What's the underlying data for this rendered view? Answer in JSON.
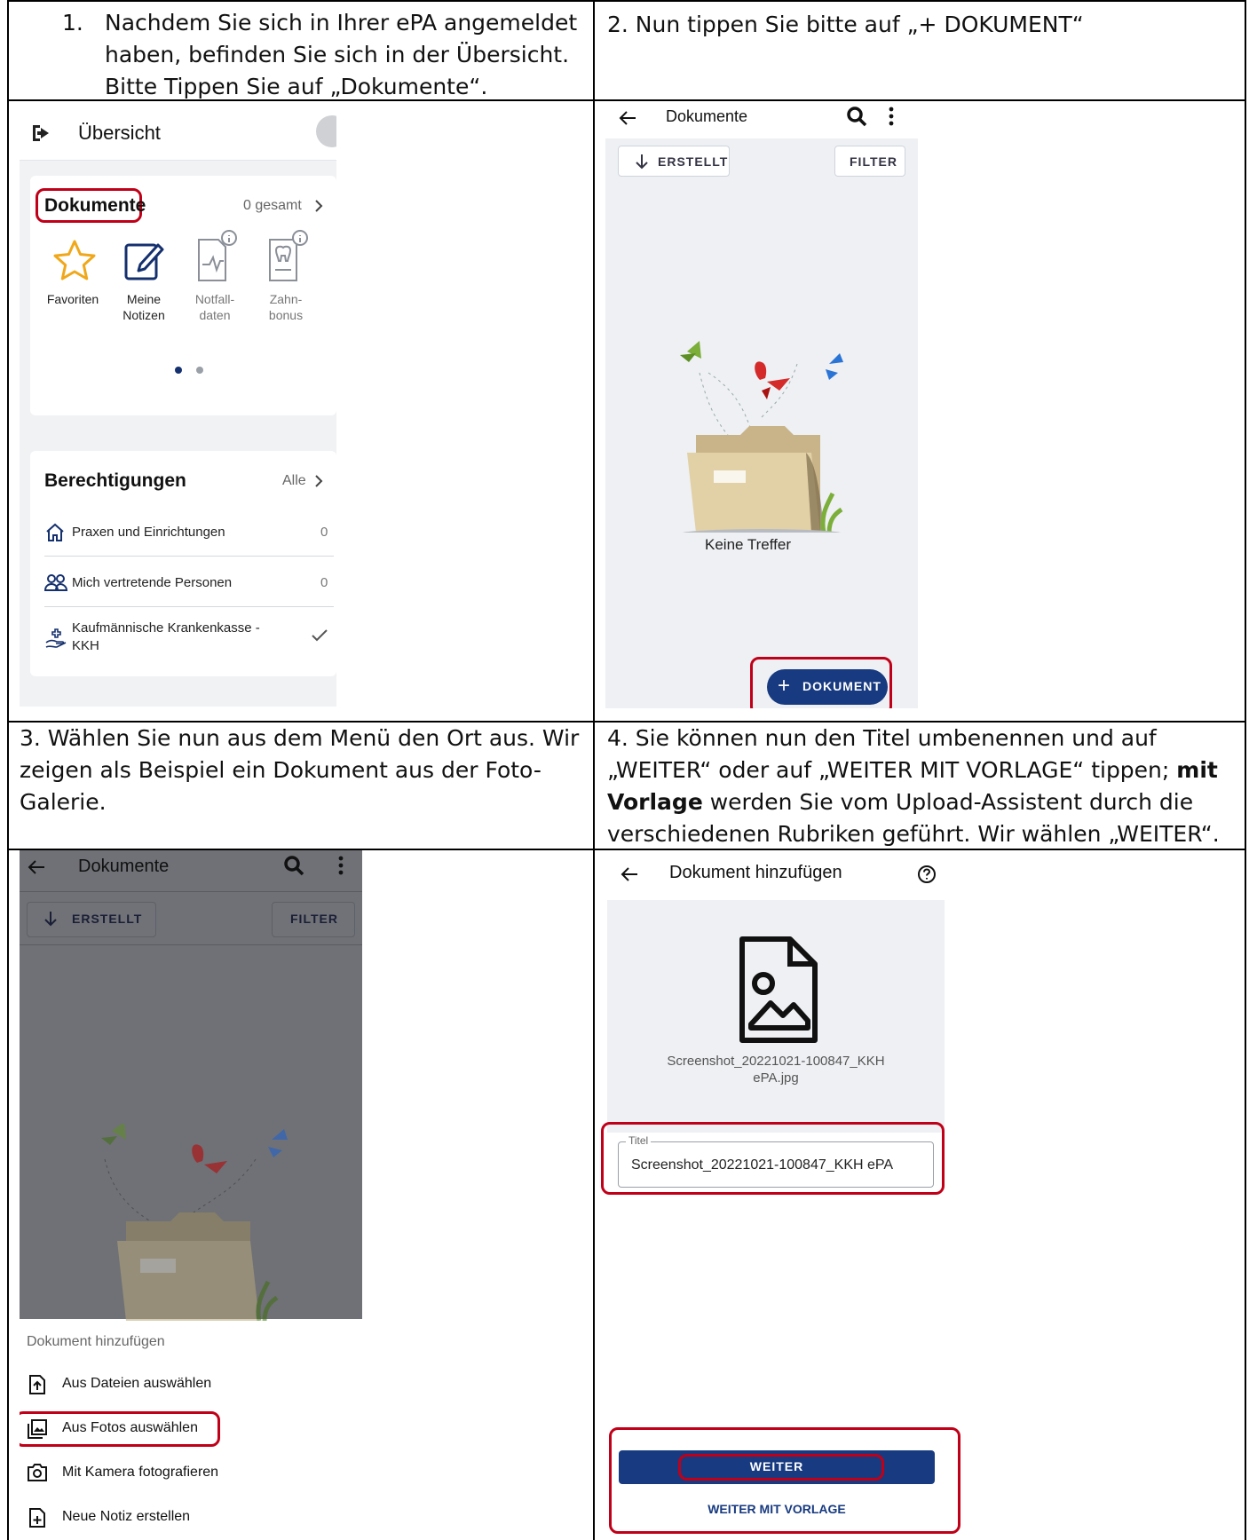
{
  "steps": [
    {
      "number": "1.",
      "text_lines": [
        "Nachdem Sie sich in Ihrer ePA angemeldet",
        "haben, befinden Sie sich in der Übersicht.",
        "Bitte Tippen Sie auf „Dokumente“."
      ]
    },
    {
      "text": "2. Nun tippen Sie bitte auf „+ DOKUMENT“"
    },
    {
      "text_lines": [
        "3. Wählen Sie nun aus dem Menü den Ort aus. Wir",
        "zeigen als Beispiel ein Dokument aus der Foto-",
        "Galerie."
      ]
    },
    {
      "line1": "4. Sie können nun den Titel umbenennen und auf",
      "line2": "„WEITER“ oder auf „WEITER MIT VORLAGE“ tippen; ",
      "line2_bold": "mit",
      "line3_bold": "Vorlage",
      "line3": " werden Sie vom Upload-Assistent durch die",
      "line4": "verschiedenen Rubriken geführt. Wir wählen „WEITER“."
    }
  ],
  "screen1": {
    "header_title": "Übersicht",
    "documents_title": "Dokumente",
    "documents_count": "0 gesamt",
    "tiles": [
      {
        "icon": "star-icon",
        "label_lines": [
          "Favoriten"
        ]
      },
      {
        "icon": "note-edit-icon",
        "label_lines": [
          "Meine",
          "Notizen"
        ]
      },
      {
        "icon": "emergency-data-icon",
        "label_lines": [
          "Notfall-",
          "daten"
        ]
      },
      {
        "icon": "tooth-icon",
        "label_lines": [
          "Zahn-",
          "bonus"
        ]
      }
    ],
    "permissions_title": "Berechtigungen",
    "permissions_all": "Alle",
    "permissions": [
      {
        "icon": "house-icon",
        "label": "Praxen und Einrichtungen",
        "value": "0"
      },
      {
        "icon": "people-icon",
        "label": "Mich vertretende Personen",
        "value": "0"
      },
      {
        "icon": "insurance-icon",
        "label_lines": [
          "Kaufmännische Krankenkasse -",
          "KKH"
        ],
        "value_icon": "check-icon"
      }
    ],
    "accent": "#1a3a8a",
    "highlight": "#c00018"
  },
  "screen2": {
    "title": "Dokumente",
    "sort_label": "ERSTELLT",
    "filter_label": "FILTER",
    "empty_text": "Keine Treffer",
    "fab_label": "DOKUMENT",
    "fab_color": "#173a80"
  },
  "screen3": {
    "title": "Dokumente",
    "sort_label": "ERSTELLT",
    "filter_label": "FILTER",
    "sheet_title": "Dokument hinzufügen",
    "options": [
      {
        "icon": "file-upload-icon",
        "label": "Aus Dateien auswählen"
      },
      {
        "icon": "photo-library-icon",
        "label": "Aus Fotos auswählen"
      },
      {
        "icon": "camera-icon",
        "label": "Mit Kamera fotografieren"
      },
      {
        "icon": "note-add-icon",
        "label": "Neue Notiz erstellen"
      }
    ]
  },
  "screen4": {
    "title": "Dokument hinzufügen",
    "filename_lines": [
      "Screenshot_20221021-100847_KKH",
      "ePA.jpg"
    ],
    "field_label": "Titel",
    "field_value": "Screenshot_20221021-100847_KKH ePA",
    "primary_button": "WEITER",
    "secondary_button": "WEITER MIT VORLAGE",
    "primary_color": "#173a80"
  }
}
